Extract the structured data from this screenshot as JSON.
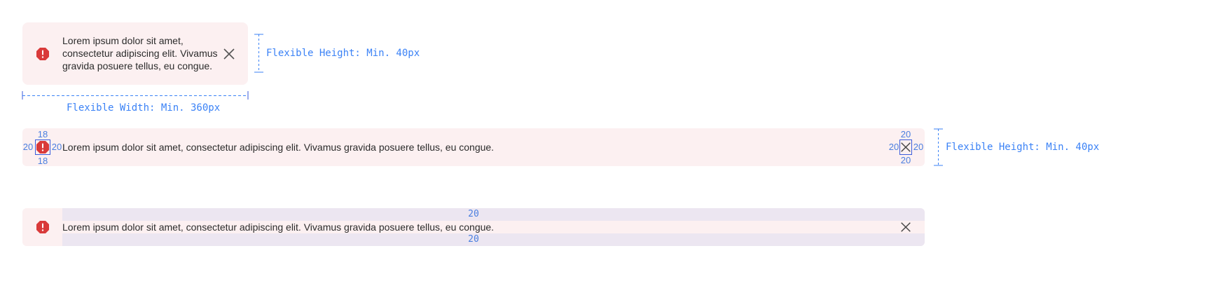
{
  "alert_text": "Lorem ipsum dolor sit amet, consectetur adipiscing elit. Vivamus gravida posuere tellus, eu congue.",
  "compact": {
    "lines": [
      "Lorem ipsum dolor sit amet,",
      "consectetur adipiscing elit. Vivamus",
      "gravida posuere tellus, eu congue."
    ]
  },
  "annotations": {
    "flex_height": "Flexible Height: Min. 40px",
    "flex_width": "Flexible Width: Min. 360px"
  },
  "spacing": {
    "icon_top": "18",
    "icon_bottom": "18",
    "icon_left": "20",
    "icon_right": "20",
    "close_top": "20",
    "close_bottom": "20",
    "close_left": "20",
    "close_right": "20",
    "text_top": "20",
    "text_bottom": "20"
  },
  "colors": {
    "alert_bg": "#fcf0f1",
    "error_red": "#d93a3a",
    "spec_blue": "#3b82f6",
    "padding_band": "#ece6f1"
  },
  "icons": {
    "error": "error-alert-icon",
    "close": "close-icon"
  }
}
